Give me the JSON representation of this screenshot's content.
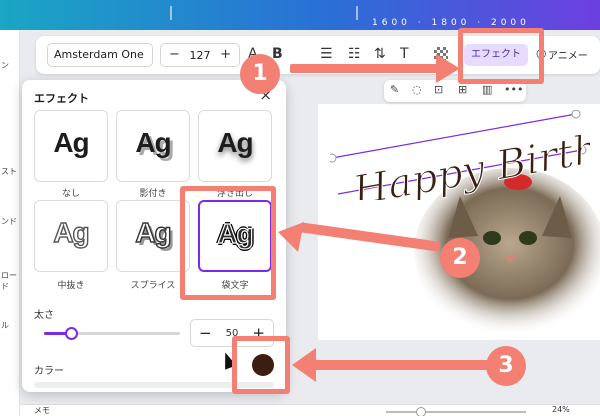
{
  "topbar": {
    "ruler_text": "1600 · 1800 · 2000"
  },
  "leftstrip": {
    "labels": [
      "ン",
      "スト",
      "ンド",
      "ロード",
      "ル"
    ]
  },
  "toolbar": {
    "font_name": "Amsterdam One",
    "font_size": "127",
    "minus": "−",
    "plus": "+",
    "text_color_glyph": "A",
    "bold_glyph": "B",
    "effect_label": "エフェクト",
    "animate_label": "アニメー"
  },
  "minibar": {
    "icons": [
      "magic-icon",
      "comment-icon",
      "lock-icon",
      "duplicate-icon",
      "delete-icon",
      "more-icon"
    ]
  },
  "panel": {
    "title": "エフェクト",
    "close": "×",
    "styles": [
      {
        "label": "なし",
        "sample": "Ag"
      },
      {
        "label": "影付き",
        "sample": "Ag"
      },
      {
        "label": "浮き出し",
        "sample": "Ag"
      },
      {
        "label": "中抜き",
        "sample": "Ag"
      },
      {
        "label": "スプライス",
        "sample": "Ag"
      },
      {
        "label": "袋文字",
        "sample": "Ag"
      }
    ],
    "thickness_label": "太さ",
    "thickness_value": "50",
    "thickness_fraction": 0.2,
    "color_label": "カラー",
    "selected_color": "#3a1e12"
  },
  "canvas": {
    "text": "Happy Birthday",
    "label_fragment": "ー",
    "text_color": "#3a1e12"
  },
  "bottombar": {
    "memo": "メモ",
    "zoom": "24%"
  },
  "annotations": {
    "step1": "1",
    "step2": "2",
    "step3": "3",
    "color": "#f47f73"
  }
}
